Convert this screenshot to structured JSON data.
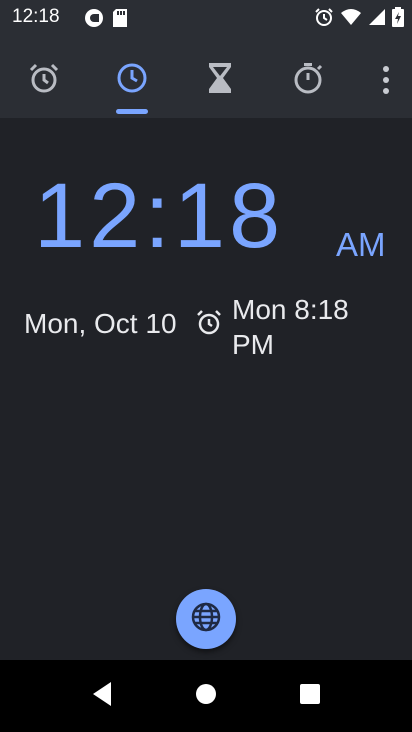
{
  "status_bar": {
    "time": "12:18",
    "left_icons": [
      "pocket-casts-icon",
      "sd-card-icon"
    ],
    "right_icons": [
      "alarm-icon",
      "wifi-icon",
      "cell-signal-icon",
      "battery-icon"
    ]
  },
  "tabs": [
    {
      "name": "alarm",
      "icon": "alarm-clock-icon",
      "selected": false
    },
    {
      "name": "clock",
      "icon": "clock-icon",
      "selected": true
    },
    {
      "name": "timer",
      "icon": "hourglass-icon",
      "selected": false
    },
    {
      "name": "stopwatch",
      "icon": "stopwatch-icon",
      "selected": false
    }
  ],
  "clock": {
    "time": "12:18",
    "ampm": "AM",
    "date": "Mon, Oct 10",
    "next_alarm": "Mon 8:18 PM"
  },
  "fab": {
    "icon": "globe-icon"
  },
  "nav": {
    "back": "back-icon",
    "home": "home-icon",
    "recents": "recents-icon"
  },
  "colors": {
    "accent": "#7aa5ff",
    "app_bar": "#2b2e34",
    "background": "#202227"
  }
}
